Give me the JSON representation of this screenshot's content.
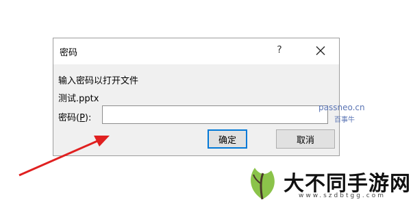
{
  "dialog": {
    "title": "密码",
    "help_label": "?",
    "prompt": "输入密码以打开文件",
    "filename": "测试.pptx",
    "password_label_prefix": "密码(",
    "password_label_hotkey": "P",
    "password_label_suffix": "):",
    "password_value": "",
    "ok_label": "确定",
    "cancel_label": "取消"
  },
  "watermark": {
    "site": "passneo.cn",
    "sub": "百事牛"
  },
  "banner": {
    "title": "大不同手游网",
    "url": "www.szdbtgg.com"
  },
  "colors": {
    "arrow": "#e02020",
    "accent": "#0078d7",
    "dialog_bg": "#f0f0f0"
  }
}
